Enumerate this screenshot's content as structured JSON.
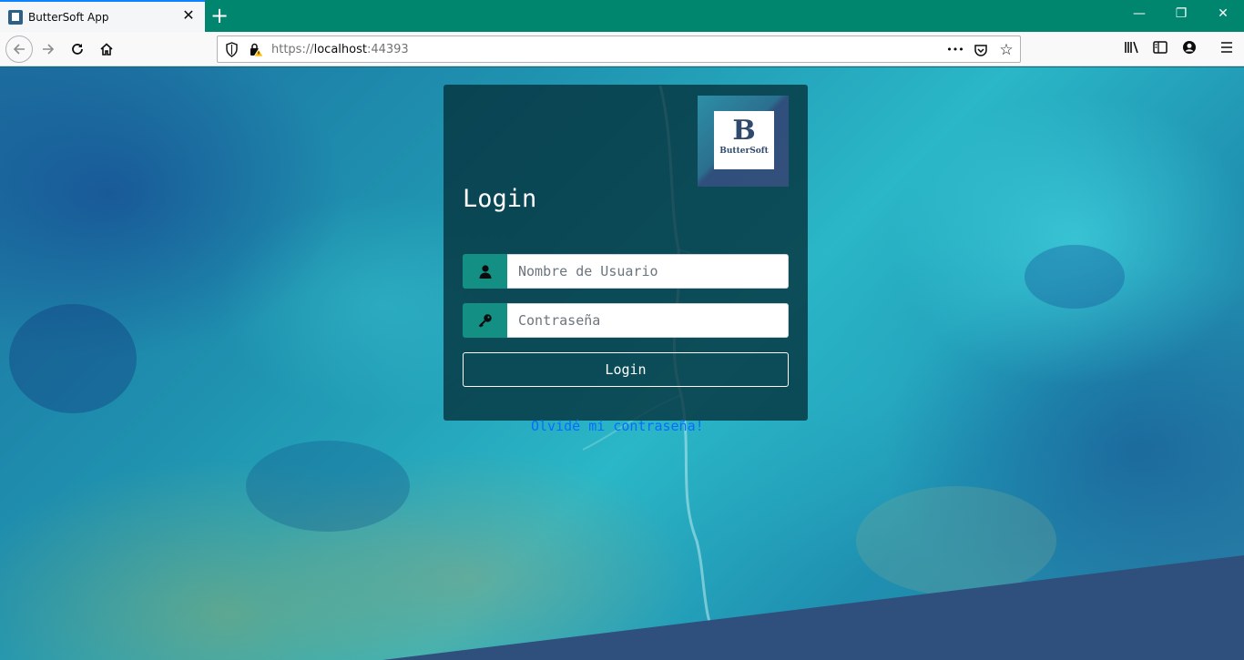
{
  "browser": {
    "tab_title": "ButterSoft App",
    "tab_close": "✕",
    "new_tab": "+",
    "window_controls": {
      "minimize": "—",
      "restore": "❐",
      "close": "✕"
    },
    "url_scheme": "https://",
    "url_host": "localhost",
    "url_port": ":44393",
    "url_more": "•••"
  },
  "logo": {
    "letter": "B",
    "name": "ButterSoft"
  },
  "login": {
    "title": "Login",
    "username_placeholder": "Nombre de Usuario",
    "password_placeholder": "Contraseña",
    "button_label": "Login",
    "forgot_link": "Olvidé mi contraseña!"
  },
  "colors": {
    "tabbar": "#00856f",
    "addon": "#139083",
    "card": "#04303a",
    "wedge": "#2f4f7d",
    "link": "#0a6cff"
  }
}
